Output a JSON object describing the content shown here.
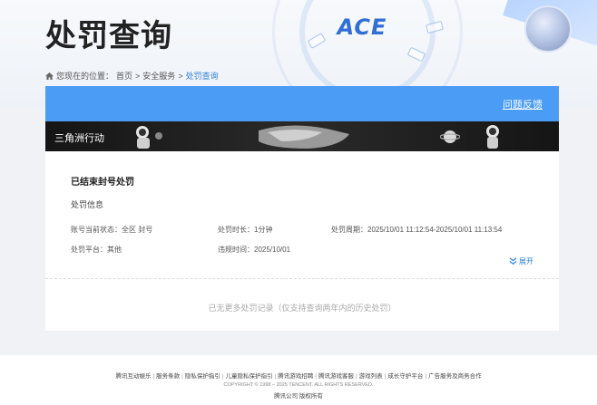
{
  "header": {
    "title": "处罚查询",
    "logo_text": "ACE"
  },
  "breadcrumb": {
    "prefix": "您现在的位置：",
    "items": [
      "首页",
      "安全服务",
      "处罚查询"
    ],
    "separator": ">"
  },
  "panel": {
    "feedback_label": "问题反馈",
    "game_name": "三角洲行动",
    "status_title": "已结束封号处罚",
    "section_title": "处罚信息",
    "fields": {
      "account_status_label": "账号当前状态：",
      "account_status_value": "全区 封号",
      "duration_label": "处罚时长：",
      "duration_value": "1分钟",
      "period_label": "处罚周期：",
      "period_value": "2025/10/01 11:12:54-2025/10/01 11:13:54",
      "platform_label": "处罚平台：",
      "platform_value": "其他",
      "violation_time_label": "违规时间：",
      "violation_time_value": "2025/10/01"
    },
    "expand_label": "展开",
    "empty_note": "已无更多处罚记录（仅支持查询两年内的历史处罚）"
  },
  "footer": {
    "links": [
      "腾讯互动娱乐",
      "服务条款",
      "隐私保护指引",
      "儿童隐私保护指引",
      "腾讯游戏招聘",
      "腾讯游戏客服",
      "游戏列表",
      "成长守护平台",
      "广告服务及商务合作"
    ],
    "copyright": "COPYRIGHT © 1998 – 2025 TENCENT. ALL RIGHTS RESERVED.",
    "company": "腾讯公司 版权所有"
  },
  "colors": {
    "accent_blue": "#4a9cf5",
    "link_blue": "#2e7fd9"
  }
}
